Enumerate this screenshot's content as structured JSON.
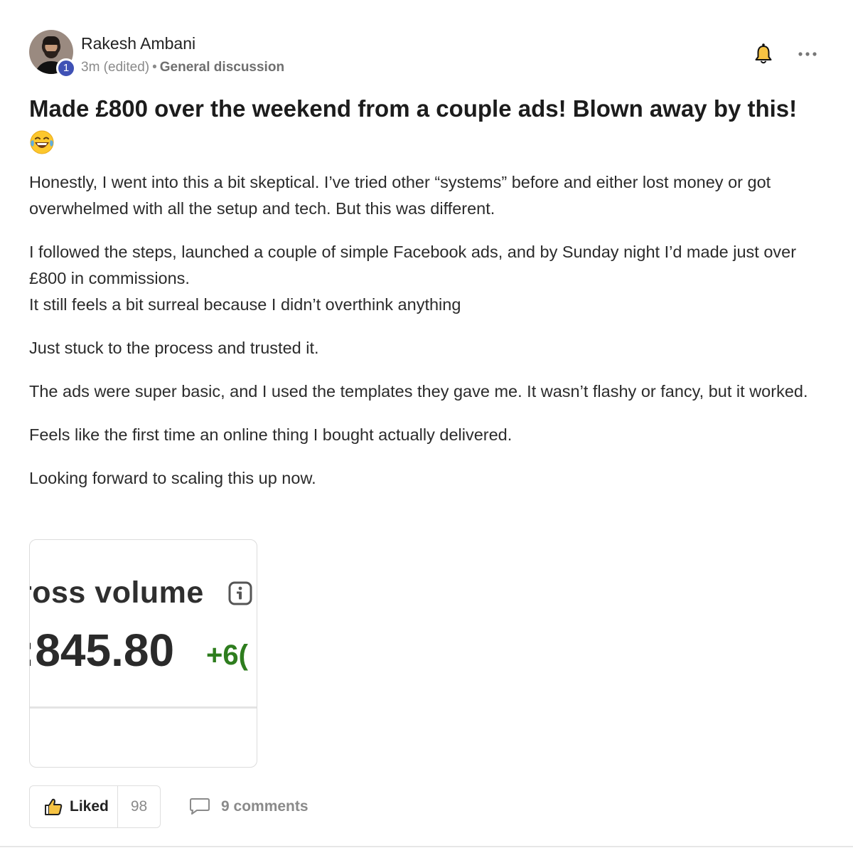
{
  "post": {
    "author": "Rakesh Ambani",
    "level": "1",
    "time": "3m (edited)",
    "separator": "•",
    "category": "General discussion",
    "title": "Made £800 over the weekend from a couple ads! Blown away by this!",
    "title_emoji": "laughing-tears-emoji",
    "paragraphs": {
      "p1": "Honestly, I went into this a bit skeptical. I’ve tried other “systems” before and either lost money or got overwhelmed with all the setup and tech. But this was different.",
      "p2a": "I followed the steps, launched a couple of simple Facebook ads, and by Sunday night I’d made just over £800 in commissions.",
      "p2b": "It still feels a bit surreal because I didn’t overthink anything",
      "p3": "Just stuck to the process and trusted it.",
      "p4": "The ads were super basic, and I used the templates they gave me. It wasn’t flashy or fancy, but it worked.",
      "p5": "Feels like the first time an online thing I bought actually delivered.",
      "p6": "Looking forward to scaling this up now."
    },
    "attachment": {
      "label": "ross volume",
      "amount": ":845.80",
      "change": "+6(",
      "change_color": "#2e7d1e"
    },
    "actions": {
      "like_label": "Liked",
      "like_count": "98",
      "comments_label": "9 comments"
    },
    "icons": {
      "bell": "bell-icon",
      "more": "more-options-icon",
      "like": "thumbs-up-icon",
      "comment": "comment-bubble-icon",
      "info": "info-icon"
    },
    "colors": {
      "level_badge": "#3f51b5",
      "text": "#2b2b2b",
      "muted": "#8a8a8a"
    }
  }
}
